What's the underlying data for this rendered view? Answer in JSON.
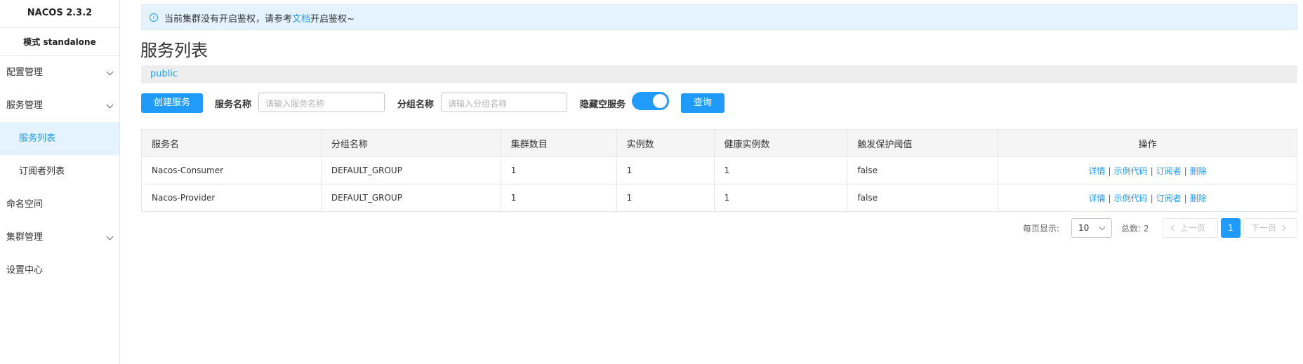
{
  "sidebar": {
    "brand": "NACOS 2.3.2",
    "mode": "模式 standalone",
    "items": [
      {
        "label": "配置管理"
      },
      {
        "label": "服务管理"
      },
      {
        "label": "服务列表"
      },
      {
        "label": "订阅者列表"
      },
      {
        "label": "命名空间"
      },
      {
        "label": "集群管理"
      },
      {
        "label": "设置中心"
      }
    ]
  },
  "notice": {
    "text_before": "当前集群没有开启鉴权，请参考",
    "link": "文档",
    "text_after": "开启鉴权~"
  },
  "page": {
    "title": "服务列表",
    "namespace": "public"
  },
  "toolbar": {
    "create_label": "创建服务",
    "service_name_label": "服务名称",
    "service_name_placeholder": "请输入服务名称",
    "group_name_label": "分组名称",
    "group_name_placeholder": "请输入分组名称",
    "hide_empty_label": "隐藏空服务",
    "hide_empty_on": true,
    "query_label": "查询"
  },
  "table": {
    "columns": [
      "服务名",
      "分组名称",
      "集群数目",
      "实例数",
      "健康实例数",
      "触发保护阈值",
      "操作"
    ],
    "rows": [
      {
        "name": "Nacos-Consumer",
        "group": "DEFAULT_GROUP",
        "clusters": "1",
        "instances": "1",
        "healthy": "1",
        "threshold": "false"
      },
      {
        "name": "Nacos-Provider",
        "group": "DEFAULT_GROUP",
        "clusters": "1",
        "instances": "1",
        "healthy": "1",
        "threshold": "false"
      }
    ],
    "actions": [
      "详情",
      "示例代码",
      "订阅者",
      "删除"
    ]
  },
  "pagination": {
    "page_size_label": "每页显示:",
    "page_size": "10",
    "total_label": "总数: 2",
    "prev": "上一页",
    "current": "1",
    "next": "下一页"
  },
  "colors": {
    "accent": "#209bfa",
    "notice_bg": "#e4f3ff"
  }
}
